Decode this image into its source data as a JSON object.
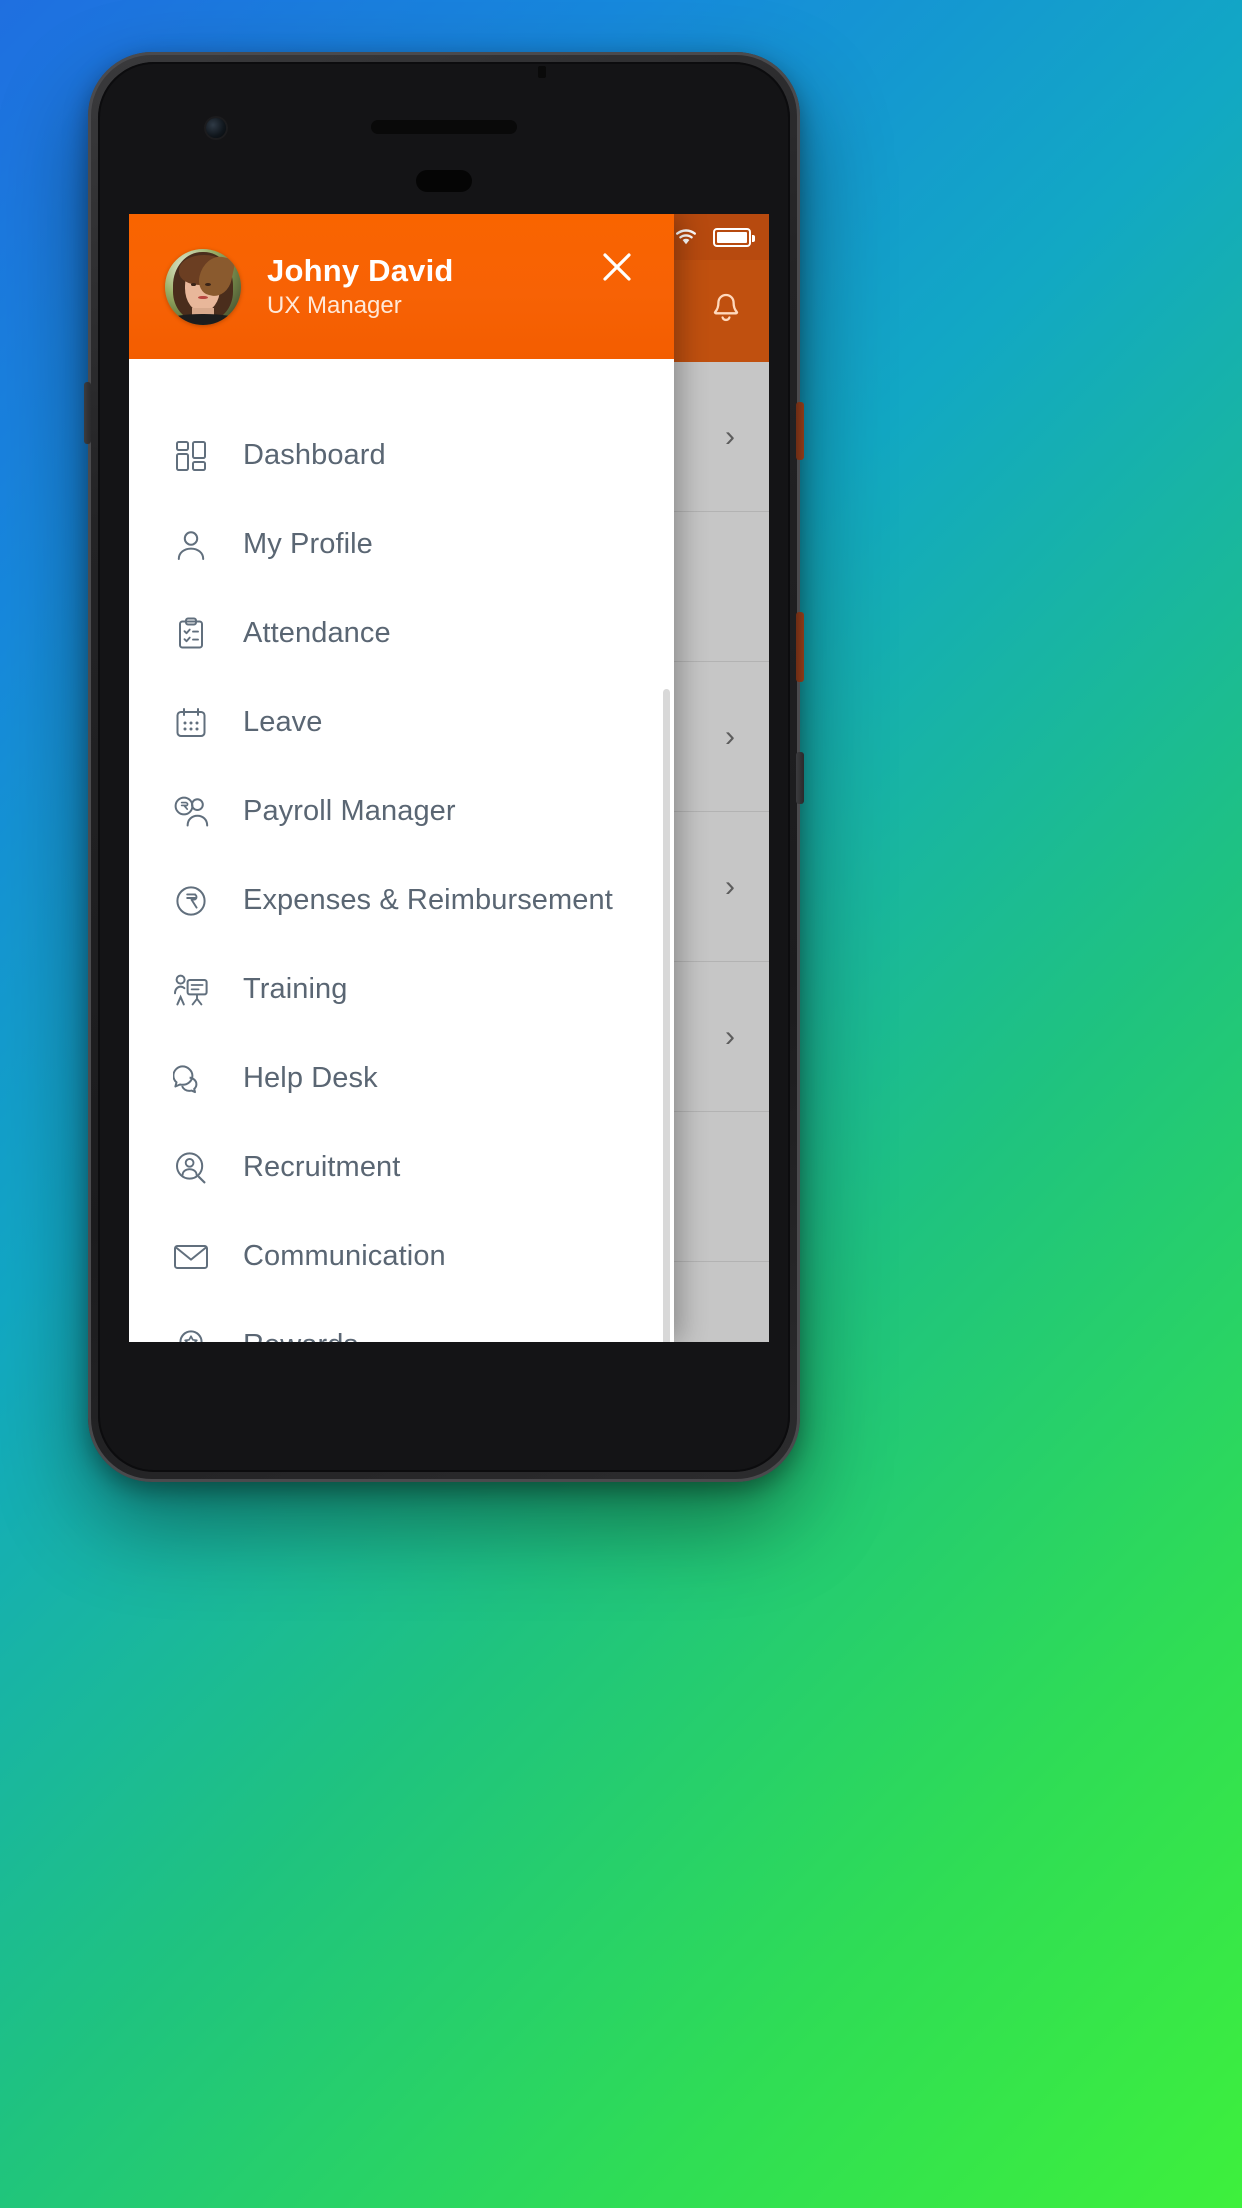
{
  "app": {
    "status_bar": {
      "wifi_icon": "wifi-icon",
      "battery_icon": "battery-icon"
    },
    "app_bar": {
      "menu_icon": "menu-icon",
      "notification_icon": "bell-icon"
    },
    "rows": [
      {
        "chevron": "›"
      },
      {
        "chevron": ""
      },
      {
        "chevron": "›"
      },
      {
        "chevron": "›"
      },
      {
        "chevron": "›"
      },
      {
        "chevron": ""
      }
    ]
  },
  "drawer": {
    "profile": {
      "name": "Johny David",
      "role": "UX Manager",
      "avatar_name": "user-avatar"
    },
    "close_label": "close-icon",
    "accent_color": "#F96400",
    "text_color": "#5A6673",
    "items": [
      {
        "label": "Dashboard",
        "icon": "dashboard-icon"
      },
      {
        "label": "My Profile",
        "icon": "person-icon"
      },
      {
        "label": "Attendance",
        "icon": "clipboard-check-icon"
      },
      {
        "label": "Leave",
        "icon": "calendar-icon"
      },
      {
        "label": "Payroll Manager",
        "icon": "payroll-people-icon"
      },
      {
        "label": "Expenses & Reimbursement",
        "icon": "rupee-circle-icon"
      },
      {
        "label": "Training",
        "icon": "presentation-icon"
      },
      {
        "label": "Help Desk",
        "icon": "chat-bubbles-icon"
      },
      {
        "label": "Recruitment",
        "icon": "person-search-icon"
      },
      {
        "label": "Communication",
        "icon": "envelope-icon"
      },
      {
        "label": "Rewards",
        "icon": "award-ribbon-icon"
      }
    ]
  }
}
